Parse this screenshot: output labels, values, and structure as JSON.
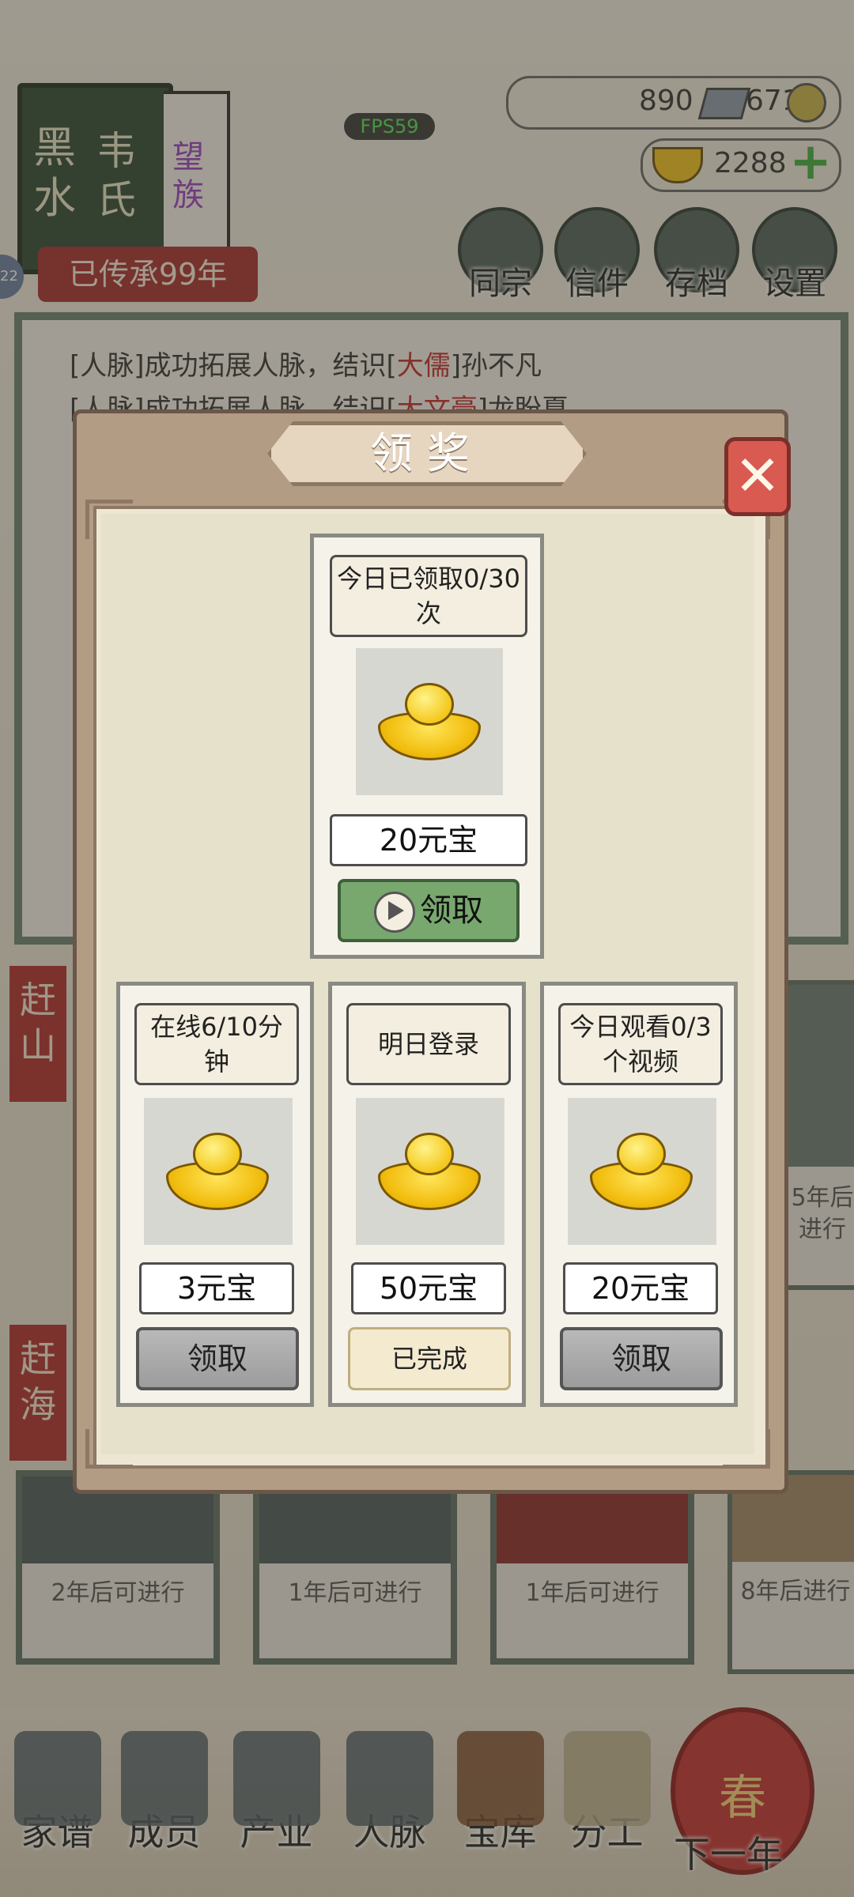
{
  "header": {
    "book_title_1": "黑水",
    "book_title_2": "韦氏",
    "book_subtitle": "望族",
    "heritage_text": "已传承99年",
    "side_badge": "22",
    "fps": "FPS59"
  },
  "resources": {
    "silver": "890",
    "coins": "671",
    "gold": "2288"
  },
  "top_nav": [
    "同宗",
    "信件",
    "存档",
    "设置"
  ],
  "log": {
    "line1_prefix": "[人脉]成功拓展人脉，结识[",
    "line1_title": "大儒",
    "line1_suffix": "]孙不凡",
    "line2_prefix": "[人脉]成功拓展人脉，结识[",
    "line2_title": "大文豪",
    "line2_suffix": "]龙盼夏"
  },
  "side_tags": [
    "赶山",
    "赶海"
  ],
  "scene_cards": [
    {
      "text": "2年后可进行"
    },
    {
      "text": "1年后可进行"
    },
    {
      "text": "1年后可进行"
    },
    {
      "text": "8年后进行"
    }
  ],
  "right_cards": [
    "5年后进行",
    "8年后进行"
  ],
  "bottom_nav": [
    "家谱",
    "成员",
    "产业",
    "人脉",
    "宝库",
    "分工"
  ],
  "next_year": {
    "label": "下一年",
    "emblem": "春"
  },
  "dialog": {
    "title": "领奖",
    "close_icon": "close-x-icon",
    "main_reward": {
      "title": "今日已领取0/30次",
      "amount": "20元宝",
      "button": "领取",
      "button_icon": "play-video-icon"
    },
    "rewards": [
      {
        "title": "在线6/10分钟",
        "amount": "3元宝",
        "button": "领取",
        "state": "disabled"
      },
      {
        "title": "明日登录",
        "amount": "50元宝",
        "button": "已完成",
        "state": "done"
      },
      {
        "title": "今日观看0/3个视频",
        "amount": "20元宝",
        "button": "领取",
        "state": "disabled"
      }
    ]
  },
  "colors": {
    "dialog_frame": "#b39c84",
    "claim_green": "#78a86e",
    "close_red": "#d95a50",
    "gold": "#f2be10"
  }
}
